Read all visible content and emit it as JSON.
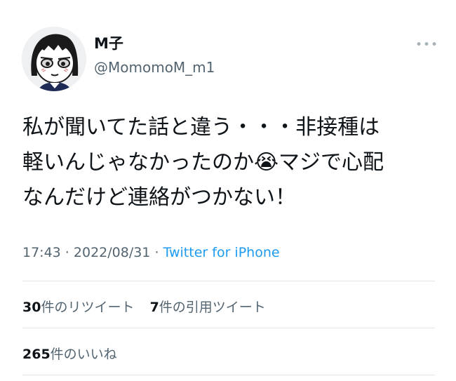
{
  "user": {
    "display_name": "M子",
    "handle": "@MomomoM_m1",
    "avatar_icon": "cartoon-girl-avatar"
  },
  "more_icon": "more-dots-icon",
  "tweet": {
    "lines": [
      "私が聞いてた話と違う・・・非接種は",
      "軽いんじゃなかったのか😭マジで心配",
      "なんだけど連絡がつかない！"
    ]
  },
  "meta": {
    "time": "17:43",
    "sep1": " · ",
    "date": "2022/08/31",
    "sep2": " · ",
    "source": "Twitter for iPhone"
  },
  "stats": {
    "retweets_count": "30",
    "retweets_label": "件のリツイート",
    "quotes_count": "7",
    "quotes_label": "件の引用ツイート",
    "likes_count": "265",
    "likes_label": "件のいいね"
  },
  "colors": {
    "text": "#0f1419",
    "secondary": "#536471",
    "link": "#1d9bf0",
    "divider": "#e1e5e8"
  }
}
